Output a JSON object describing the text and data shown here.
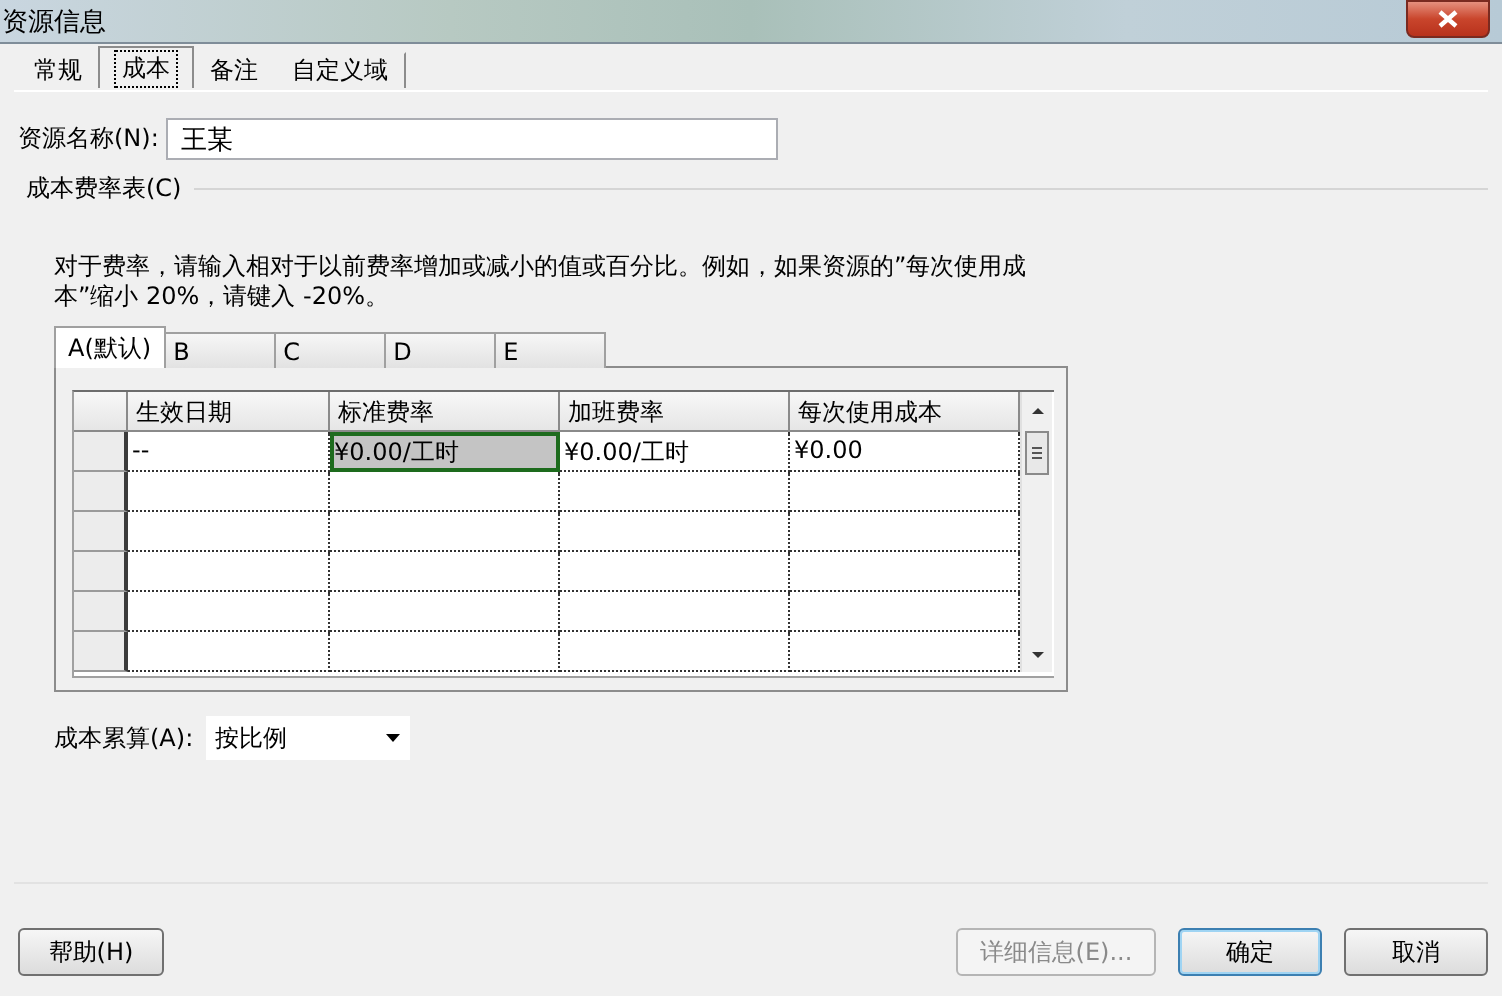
{
  "window": {
    "title": "资源信息"
  },
  "tabs": [
    {
      "label": "常规",
      "selected": false
    },
    {
      "label": "成本",
      "selected": true
    },
    {
      "label": "备注",
      "selected": false
    },
    {
      "label": "自定义域",
      "selected": false
    }
  ],
  "resource_name": {
    "label": "资源名称(N):",
    "value": "王某"
  },
  "cost_rate_table": {
    "label": "成本费率表(C)",
    "note": "对于费率，请输入相对于以前费率增加或减小的值或百分比。例如，如果资源的”每次使用成本”缩小 20%，请键入 -20%。",
    "tabs": [
      {
        "label": "A(默认)",
        "selected": true
      },
      {
        "label": "B",
        "selected": false
      },
      {
        "label": "C",
        "selected": false
      },
      {
        "label": "D",
        "selected": false
      },
      {
        "label": "E",
        "selected": false
      }
    ],
    "columns": [
      "生效日期",
      "标准费率",
      "加班费率",
      "每次使用成本"
    ],
    "rows": [
      {
        "cells": [
          {
            "text": "--",
            "selected": false
          },
          {
            "text": "¥0.00/工时",
            "selected": true
          },
          {
            "text": "¥0.00/工时",
            "selected": false
          },
          {
            "text": "¥0.00",
            "selected": false
          }
        ]
      }
    ]
  },
  "cost_accrual": {
    "label": "成本累算(A):",
    "value": "按比例"
  },
  "buttons": [
    {
      "label": "帮助(H)",
      "kind": "help",
      "disabled": false,
      "default": false
    },
    {
      "label": "详细信息(E)...",
      "kind": "details",
      "disabled": true,
      "default": false
    },
    {
      "label": "确定",
      "kind": "ok",
      "disabled": false,
      "default": true
    },
    {
      "label": "取消",
      "kind": "cancel",
      "disabled": false,
      "default": false
    }
  ]
}
